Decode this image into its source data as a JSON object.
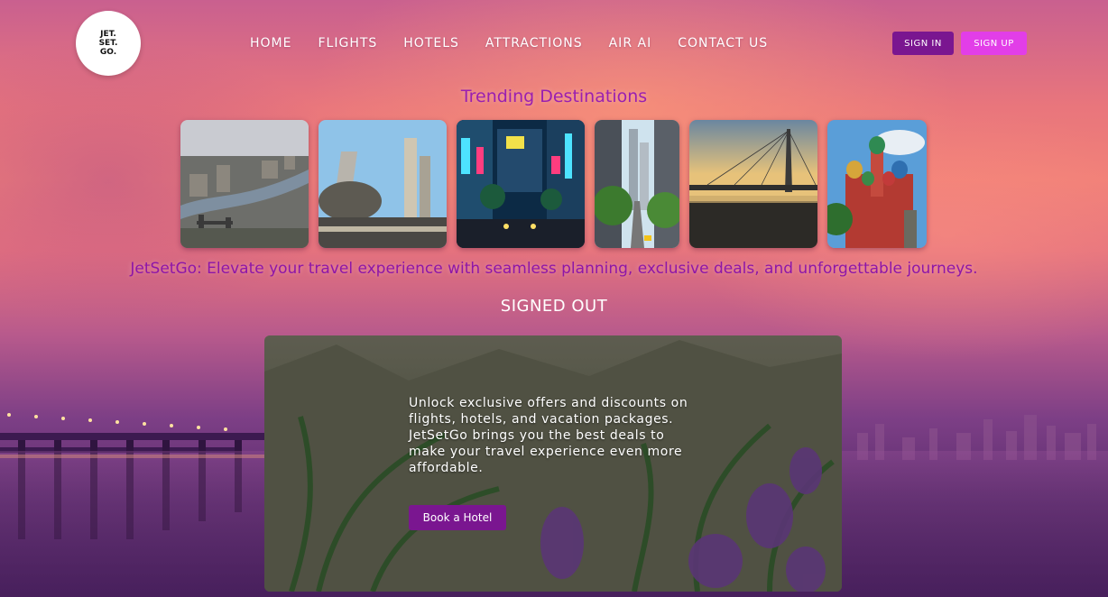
{
  "logo": {
    "text": "JET.\nSET.\nGO."
  },
  "nav": {
    "items": [
      {
        "label": "HOME"
      },
      {
        "label": "FLIGHTS"
      },
      {
        "label": "HOTELS"
      },
      {
        "label": "ATTRACTIONS"
      },
      {
        "label": "AIR AI"
      },
      {
        "label": "CONTACT US"
      }
    ]
  },
  "auth": {
    "signin_label": "SIGN IN",
    "signup_label": "SIGN UP"
  },
  "trending": {
    "title": "Trending Destinations"
  },
  "tagline": "JetSetGo: Elevate your travel experience with seamless planning, exclusive deals, and unforgettable journeys.",
  "status": "SIGNED OUT",
  "promo": {
    "text": "Unlock exclusive offers and discounts on flights, hotels, and vacation packages. JetSetGo brings you the best deals to make your travel experience even more affordable.",
    "button_label": "Book a Hotel"
  },
  "colors": {
    "primary_purple": "#7a1690",
    "accent_magenta": "#e23ee8",
    "heading_purple": "#9a1fb0"
  }
}
